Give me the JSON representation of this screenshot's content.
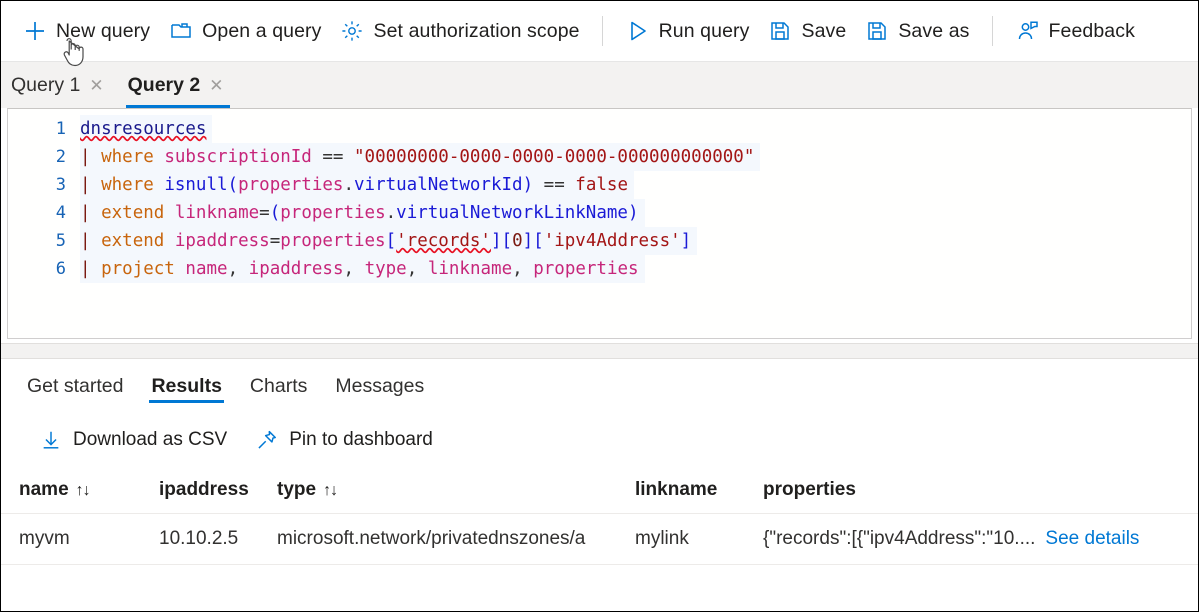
{
  "toolbar": {
    "items": [
      {
        "id": "new-query",
        "label": "New query",
        "icon": "plus-icon"
      },
      {
        "id": "open-query",
        "label": "Open a query",
        "icon": "folder-icon"
      },
      {
        "id": "auth-scope",
        "label": "Set authorization scope",
        "icon": "gear-icon"
      },
      {
        "id": "run-query",
        "label": "Run query",
        "icon": "play-icon"
      },
      {
        "id": "save",
        "label": "Save",
        "icon": "save-icon"
      },
      {
        "id": "save-as",
        "label": "Save as",
        "icon": "save-as-icon"
      },
      {
        "id": "feedback",
        "label": "Feedback",
        "icon": "feedback-icon"
      }
    ]
  },
  "query_tabs": {
    "items": [
      {
        "label": "Query 1",
        "close": "✕",
        "active": false
      },
      {
        "label": "Query 2",
        "close": "✕",
        "active": true
      }
    ]
  },
  "editor": {
    "lines": [
      {
        "n": "1",
        "text": "dnsresources"
      },
      {
        "n": "2",
        "text": "| where subscriptionId == \"00000000-0000-0000-0000-000000000000\""
      },
      {
        "n": "3",
        "text": "| where isnull(properties.virtualNetworkId) == false"
      },
      {
        "n": "4",
        "text": "| extend linkname=(properties.virtualNetworkLinkName)"
      },
      {
        "n": "5",
        "text": "| extend ipaddress=properties['records'][0]['ipv4Address']"
      },
      {
        "n": "6",
        "text": "| project name, ipaddress, type, linkname, properties"
      }
    ],
    "tokens": {
      "table_name": "dnsresources",
      "pipe": "|",
      "kw_where": "where",
      "kw_extend": "extend",
      "kw_project": "project",
      "fn_isnull": "isnull",
      "id_subscriptionId": "subscriptionId",
      "id_properties": "properties",
      "id_virtualNetworkId": "virtualNetworkId",
      "id_virtualNetworkLinkName": "virtualNetworkLinkName",
      "id_linkname": "linkname",
      "id_ipaddress": "ipaddress",
      "id_name": "name",
      "id_type": "type",
      "op_eqeq": "==",
      "op_eq": "=",
      "op_dot": ".",
      "guid_literal": "\"00000000-0000-0000-0000-000000000000\"",
      "bool_false": "false",
      "str_records": "'records'",
      "str_ipv4": "'ipv4Address'",
      "num_zero": "0",
      "comma": ",",
      "paren_open": "(",
      "paren_close": ")",
      "bracket_open": "[",
      "bracket_close": "]"
    }
  },
  "results": {
    "tabs": [
      {
        "label": "Get started",
        "active": false
      },
      {
        "label": "Results",
        "active": true
      },
      {
        "label": "Charts",
        "active": false
      },
      {
        "label": "Messages",
        "active": false
      }
    ],
    "actions": [
      {
        "label": "Download as CSV",
        "icon": "download-icon"
      },
      {
        "label": "Pin to dashboard",
        "icon": "pin-icon"
      }
    ],
    "table": {
      "columns": [
        {
          "label": "name",
          "sortable": true,
          "sort_icon": "↑↓"
        },
        {
          "label": "ipaddress",
          "sortable": false,
          "sort_icon": ""
        },
        {
          "label": "type",
          "sortable": true,
          "sort_icon": "↑↓"
        },
        {
          "label": "linkname",
          "sortable": false,
          "sort_icon": ""
        },
        {
          "label": "properties",
          "sortable": false,
          "sort_icon": ""
        }
      ],
      "rows": [
        {
          "name": "myvm",
          "ipaddress": "10.10.2.5",
          "type": "microsoft.network/privatednszones/a",
          "linkname": "mylink",
          "properties": "{\"records\":[{\"ipv4Address\":\"10....",
          "details_link": "See details"
        }
      ]
    }
  },
  "colors": {
    "accent": "#0078d4",
    "text": "#201f1e",
    "tab_strip_bg": "#f3f2f1",
    "editor_line_bg": "#f4f8fd",
    "squiggle": "#e81123",
    "link": "#0078d4"
  }
}
